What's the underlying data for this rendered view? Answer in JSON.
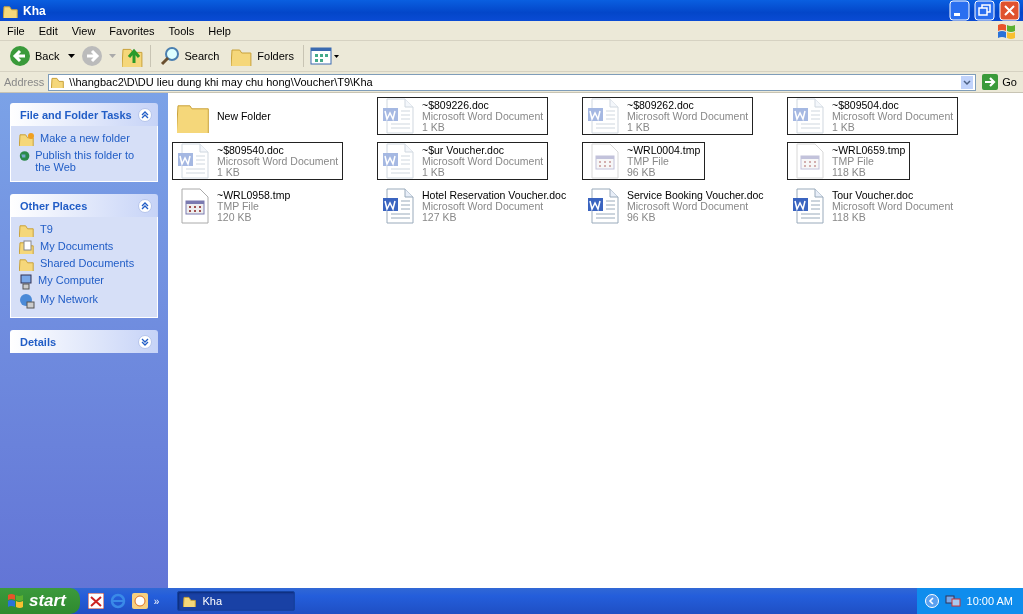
{
  "window": {
    "title": "Kha"
  },
  "menu": [
    "File",
    "Edit",
    "View",
    "Favorites",
    "Tools",
    "Help"
  ],
  "toolbar": {
    "back": "Back",
    "search": "Search",
    "folders": "Folders"
  },
  "address": {
    "label": "Address",
    "value": "\\\\hangbac2\\D\\DU lieu dung khi may chu hong\\Voucher\\T9\\Kha",
    "go": "Go"
  },
  "sidebar": [
    {
      "title": "File and Folder Tasks",
      "expanded": true,
      "items": [
        {
          "label": "Make a new folder",
          "kind": "newfolder"
        },
        {
          "label": "Publish this folder to the Web",
          "kind": "web"
        }
      ]
    },
    {
      "title": "Other Places",
      "expanded": true,
      "items": [
        {
          "label": "T9",
          "kind": "folder"
        },
        {
          "label": "My Documents",
          "kind": "documents"
        },
        {
          "label": "Shared Documents",
          "kind": "folder"
        },
        {
          "label": "My Computer",
          "kind": "computer"
        },
        {
          "label": "My Network",
          "kind": "network"
        }
      ]
    },
    {
      "title": "Details",
      "expanded": false
    }
  ],
  "files": [
    {
      "name": "New Folder",
      "kind": "folder",
      "hidden": false
    },
    {
      "name": "~$809226.doc",
      "type": "Microsoft Word Document",
      "size": "1 KB",
      "kind": "word",
      "hidden": true
    },
    {
      "name": "~$809262.doc",
      "type": "Microsoft Word Document",
      "size": "1 KB",
      "kind": "word",
      "hidden": true
    },
    {
      "name": "~$809504.doc",
      "type": "Microsoft Word Document",
      "size": "1 KB",
      "kind": "word",
      "hidden": true
    },
    {
      "name": "~$809540.doc",
      "type": "Microsoft Word Document",
      "size": "1 KB",
      "kind": "word",
      "hidden": true
    },
    {
      "name": "~$ur Voucher.doc",
      "type": "Microsoft Word Document",
      "size": "1 KB",
      "kind": "word",
      "hidden": true
    },
    {
      "name": "~WRL0004.tmp",
      "type": "TMP File",
      "size": "96 KB",
      "kind": "tmp",
      "hidden": true
    },
    {
      "name": "~WRL0659.tmp",
      "type": "TMP File",
      "size": "118 KB",
      "kind": "tmp",
      "hidden": true
    },
    {
      "name": "~WRL0958.tmp",
      "type": "TMP File",
      "size": "120 KB",
      "kind": "tmp",
      "hidden": false
    },
    {
      "name": "Hotel Reservation Voucher.doc",
      "type": "Microsoft Word Document",
      "size": "127 KB",
      "kind": "word",
      "hidden": false
    },
    {
      "name": "Service Booking Voucher.doc",
      "type": "Microsoft Word Document",
      "size": "96 KB",
      "kind": "word",
      "hidden": false
    },
    {
      "name": "Tour Voucher.doc",
      "type": "Microsoft Word Document",
      "size": "118 KB",
      "kind": "word",
      "hidden": false
    }
  ],
  "taskbar": {
    "start": "start",
    "quicklaunch_more": "»",
    "tasks": [
      {
        "label": "Kha",
        "selected": true
      }
    ],
    "clock": "10:00 AM"
  }
}
